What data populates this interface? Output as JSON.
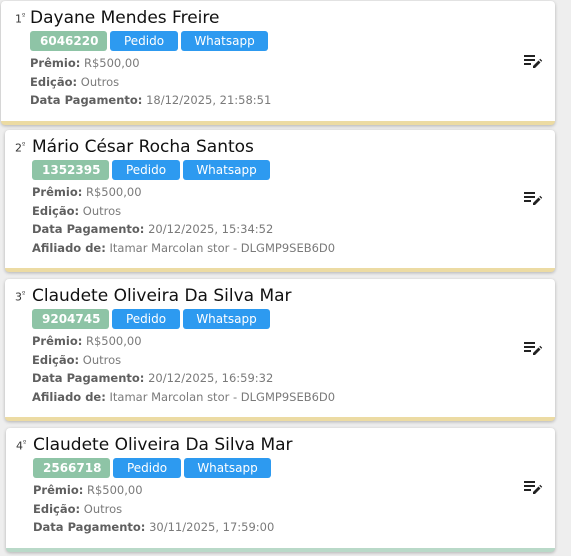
{
  "labels": {
    "premio": "Prêmio:",
    "edicao": "Edição:",
    "data_pagamento": "Data Pagamento:",
    "afiliado": "Afiliado de:",
    "pedido_button": "Pedido",
    "whatsapp_button": "Whatsapp"
  },
  "winners": [
    {
      "rank": "1",
      "rank_suffix": "º",
      "name": "Dayane Mendes Freire",
      "code": "6046220",
      "premio": "R$500,00",
      "edicao": "Outros",
      "data_pagamento": "18/12/2025, 21:58:51"
    },
    {
      "rank": "2",
      "rank_suffix": "º",
      "name": "Mário César Rocha Santos",
      "code": "1352395",
      "premio": "R$500,00",
      "edicao": "Outros",
      "data_pagamento": "20/12/2025, 15:34:52",
      "afiliado": "Itamar Marcolan stor - DLGMP9SEB6D0"
    },
    {
      "rank": "3",
      "rank_suffix": "º",
      "name": "Claudete Oliveira Da Silva Mar",
      "code": "9204745",
      "premio": "R$500,00",
      "edicao": "Outros",
      "data_pagamento": "20/12/2025, 16:59:32",
      "afiliado": "Itamar Marcolan stor - DLGMP9SEB6D0"
    },
    {
      "rank": "4",
      "rank_suffix": "º",
      "name": "Claudete Oliveira Da Silva Mar",
      "code": "2566718",
      "premio": "R$500,00",
      "edicao": "Outros",
      "data_pagamento": "30/11/2025, 17:59:00"
    }
  ],
  "colors": {
    "code_chip": "#8ec4a6",
    "action_chip": "#2d9af0",
    "card_border_paid": "#ecdba3",
    "card_border_last": "#b9d9c8"
  },
  "icons": {
    "edit": "playlist-edit-icon"
  }
}
